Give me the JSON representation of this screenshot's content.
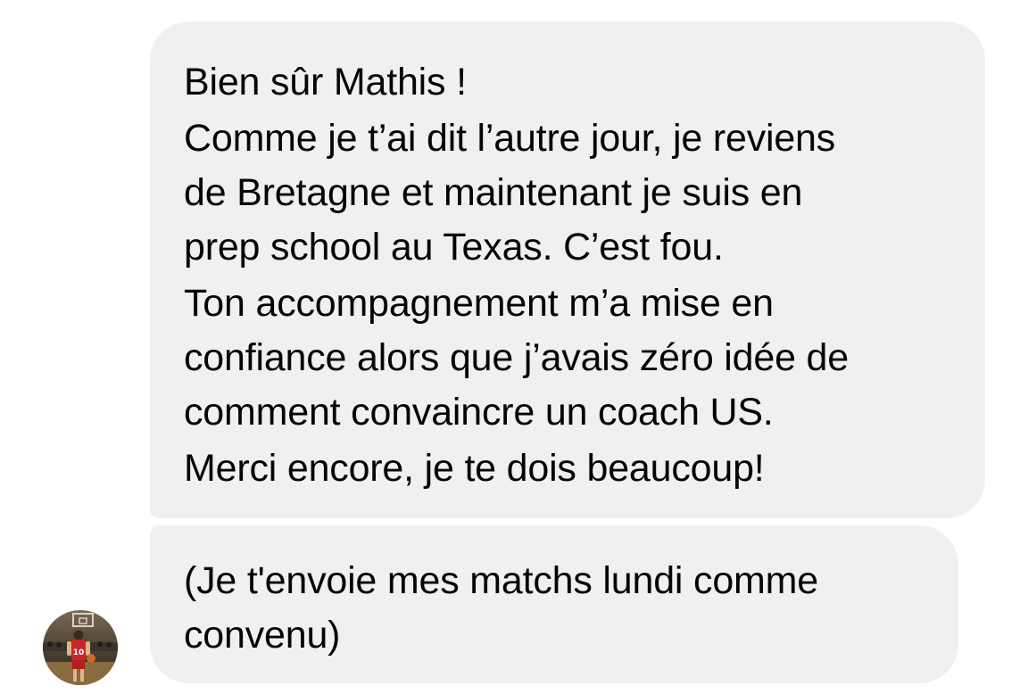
{
  "messages": [
    {
      "paragraphs": [
        "Bien sûr Mathis !",
        "Comme je t’ai dit l’autre jour, je reviens\nde Bretagne et maintenant je suis en\nprep school au Texas. C’est fou.",
        "Ton accompagnement m’a mise en\nconfiance alors que j’avais zéro idée de\ncomment convaincre un coach US.",
        "Merci encore, je te dois beaucoup!"
      ]
    },
    {
      "paragraphs": [
        "(Je t'envoie mes matchs lundi comme\nconvenu)"
      ]
    }
  ],
  "avatar": {
    "icon": "basketball-player-avatar",
    "jersey_number": "10",
    "jersey_color": "#c62828"
  },
  "colors": {
    "bubble_background": "#f0f0f2",
    "text": "#050505",
    "page_background": "#ffffff"
  }
}
